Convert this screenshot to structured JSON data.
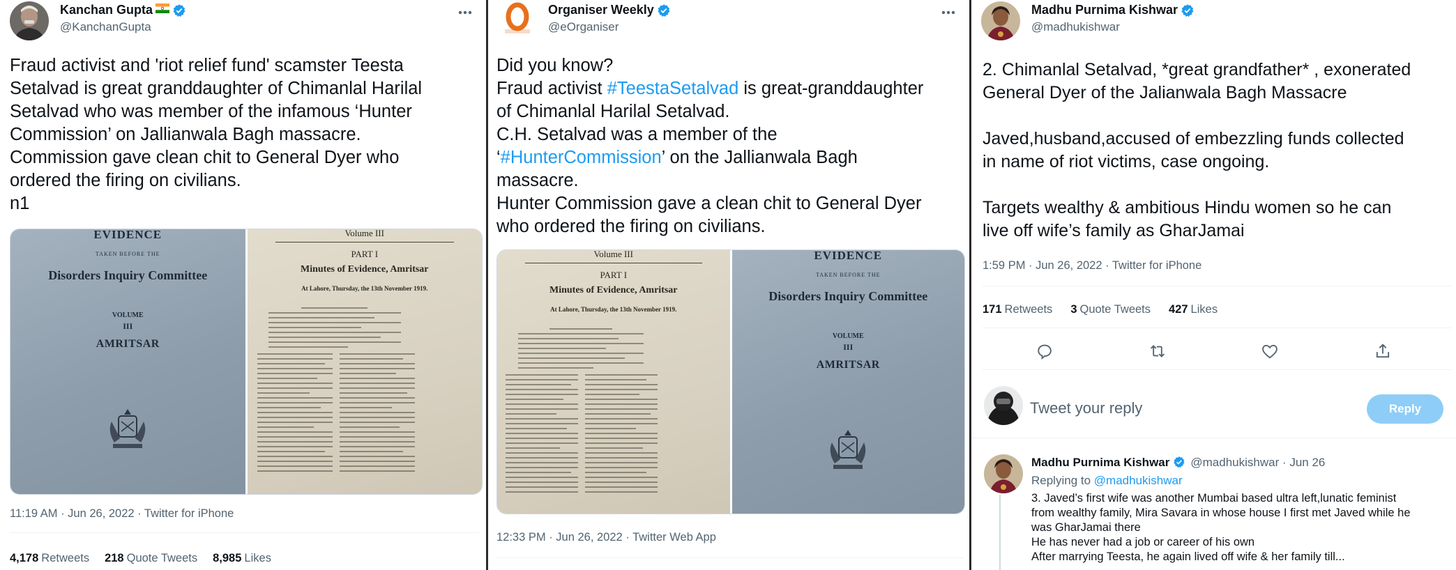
{
  "tweet1": {
    "name": "Kanchan Gupta",
    "handle": "@KanchanGupta",
    "text": "Fraud activist and 'riot relief fund' scamster Teesta\nSetalvad is great granddaughter of Chimanlal Harilal\nSetalvad who was member of the infamous ‘Hunter\nCommission’ on Jallianwala Bagh massacre.\nCommission gave clean chit to General Dyer who\nordered the firing on civilians.\nn1",
    "photo_left": {
      "title": "EVIDENCE",
      "subtitle": "TAKEN BEFORE THE",
      "committee": "Disorders Inquiry Committee",
      "volume_label": "VOLUME",
      "volume_number": "III",
      "city": "AMRITSAR"
    },
    "photo_right": {
      "volume": "Volume III",
      "part": "PART I",
      "heading": "Minutes of Evidence, Amritsar",
      "date_line": "At Lahore, Thursday, the 13th November 1919."
    },
    "meta": "11:19 AM · Jun 26, 2022 · Twitter for iPhone",
    "retweets_count": "4,178",
    "retweets_label": "Retweets",
    "quotes_count": "218",
    "quotes_label": "Quote Tweets",
    "likes_count": "8,985",
    "likes_label": "Likes"
  },
  "tweet2": {
    "name": "Organiser Weekly",
    "handle": "@eOrganiser",
    "line1": "Did you know?",
    "line2_pre": "Fraud activist ",
    "line2_tag": "#TeestaSetalvad",
    "line2_post": " is great-granddaughter",
    "line3": "of Chimanlal Harilal Setalvad.",
    "line4": "C.H. Setalvad was a member of the",
    "line5_pre": "‘",
    "line5_tag": "#HunterCommission",
    "line5_post": "’ on the Jallianwala Bagh",
    "line6": "massacre.",
    "line7": "Hunter Commission gave a clean chit to General Dyer",
    "line8": "who ordered the firing on civilians.",
    "meta": "12:33 PM · Jun 26, 2022 · Twitter Web App"
  },
  "tweet3": {
    "name": "Madhu Purnima Kishwar",
    "handle": "@madhukishwar",
    "text": "2. Chimanlal Setalvad, *great grandfather* , exonerated\nGeneral Dyer of the Jalianwala Bagh Massacre\n\nJaved,husband,accused of embezzling funds collected\nin name of riot victims, case ongoing.\n\nTargets wealthy & ambitious Hindu women so he can\nlive off wife’s family as GharJamai",
    "meta": "1:59 PM · Jun 26, 2022 · Twitter for iPhone",
    "retweets_count": "171",
    "retweets_label": "Retweets",
    "quotes_count": "3",
    "quotes_label": "Quote Tweets",
    "likes_count": "427",
    "likes_label": "Likes",
    "reply_placeholder": "Tweet your reply",
    "reply_button": "Reply",
    "reply": {
      "name": "Madhu Purnima Kishwar",
      "handle_time": "@madhukishwar · Jun 26",
      "replying_prefix": "Replying to ",
      "replying_handle": "@madhukishwar",
      "text": "3. Javed’s first wife was another Mumbai based ultra left,lunatic feminist\nfrom wealthy family, Mira Savara in whose house I first met Javed while he\nwas GharJamai there\nHe has never had a job or career of his own\nAfter marrying Teesta, he again lived off wife & her family till..."
    }
  },
  "colors": {
    "verified": "#1d9bf0",
    "link": "#1d9bf0",
    "secondary_text": "#536471",
    "reply_button": "#8ecdf7"
  },
  "icons": [
    "verified-badge-icon",
    "india-flag-icon",
    "more-options-icon",
    "reply-icon",
    "retweet-icon",
    "like-icon",
    "share-icon"
  ]
}
